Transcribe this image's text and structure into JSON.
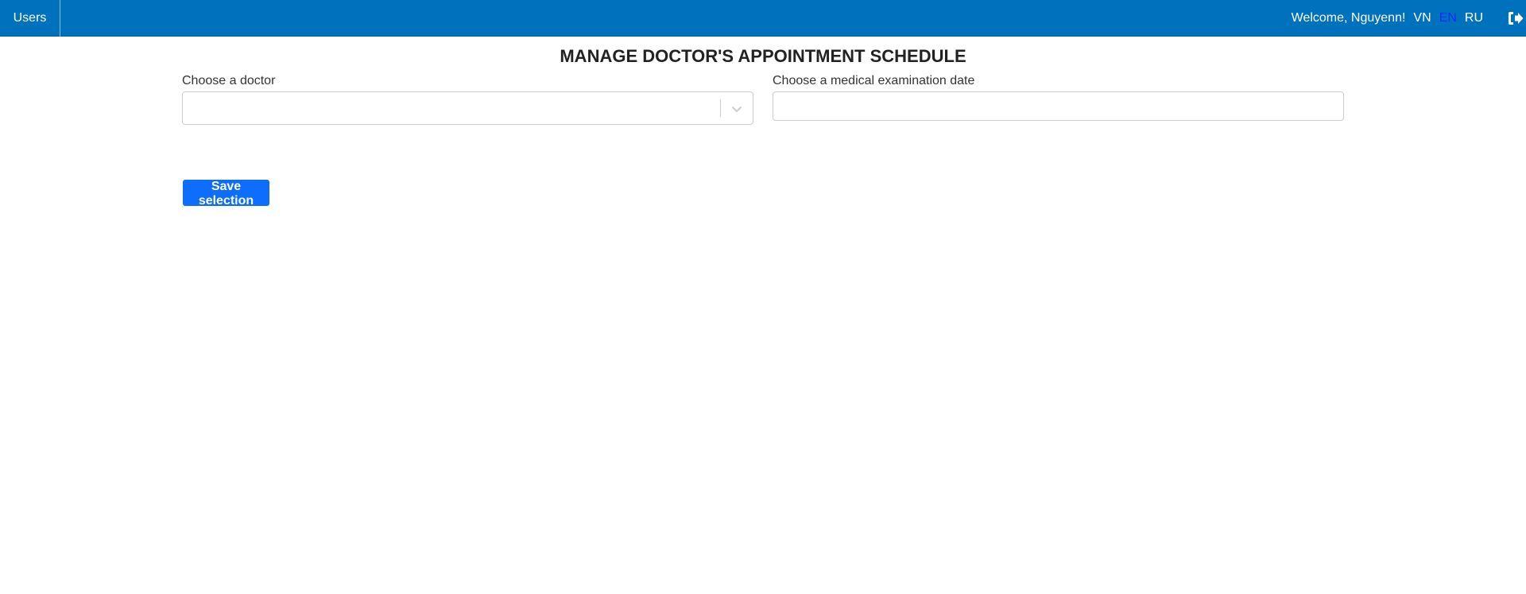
{
  "header": {
    "nav_users": "Users",
    "welcome": "Welcome, Nguyenn!",
    "languages": [
      "VN",
      "EN",
      "RU"
    ],
    "active_language": "EN",
    "logout_icon": "sign-out-icon"
  },
  "main": {
    "title": "MANAGE DOCTOR'S APPOINTMENT SCHEDULE",
    "doctor_label": "Choose a doctor",
    "doctor_value": "",
    "date_label": "Choose a medical examination date",
    "date_value": "",
    "save_label": "Save selection"
  },
  "colors": {
    "topbar": "#0071bc",
    "active_language": "#0d2bff",
    "save_button": "#0d6efd"
  }
}
